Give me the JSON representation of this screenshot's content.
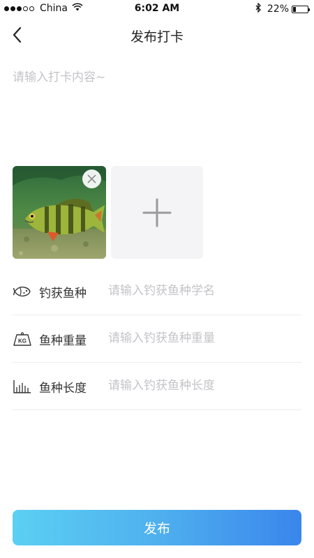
{
  "status_bar": {
    "carrier": "China",
    "time": "6:02 AM",
    "battery_percent": "22%",
    "battery_level": 0.22,
    "signal_bars_filled": 3,
    "signal_bars_total": 5
  },
  "nav": {
    "title": "发布打卡",
    "back_icon": "chevron-left-icon"
  },
  "content": {
    "placeholder": "请输入打卡内容~",
    "value": ""
  },
  "photos": {
    "items": [
      {
        "icon": "fish-photo",
        "remove_icon": "close-icon"
      }
    ],
    "add_icon": "plus-icon"
  },
  "form": {
    "rows": [
      {
        "icon": "fish-icon",
        "label": "钓获鱼种",
        "placeholder": "请输入钓获鱼种学名",
        "value": ""
      },
      {
        "icon": "weight-kg-icon",
        "label": "鱼种重量",
        "placeholder": "请输入钓获鱼种重量",
        "value": "",
        "icon_text": "KG"
      },
      {
        "icon": "ruler-icon",
        "label": "鱼种长度",
        "placeholder": "请输入钓获鱼种长度",
        "value": ""
      }
    ]
  },
  "submit": {
    "label": "发布"
  },
  "colors": {
    "accent_start": "#5bd0f3",
    "accent_end": "#3a86ec",
    "placeholder": "#c4c4c8"
  }
}
